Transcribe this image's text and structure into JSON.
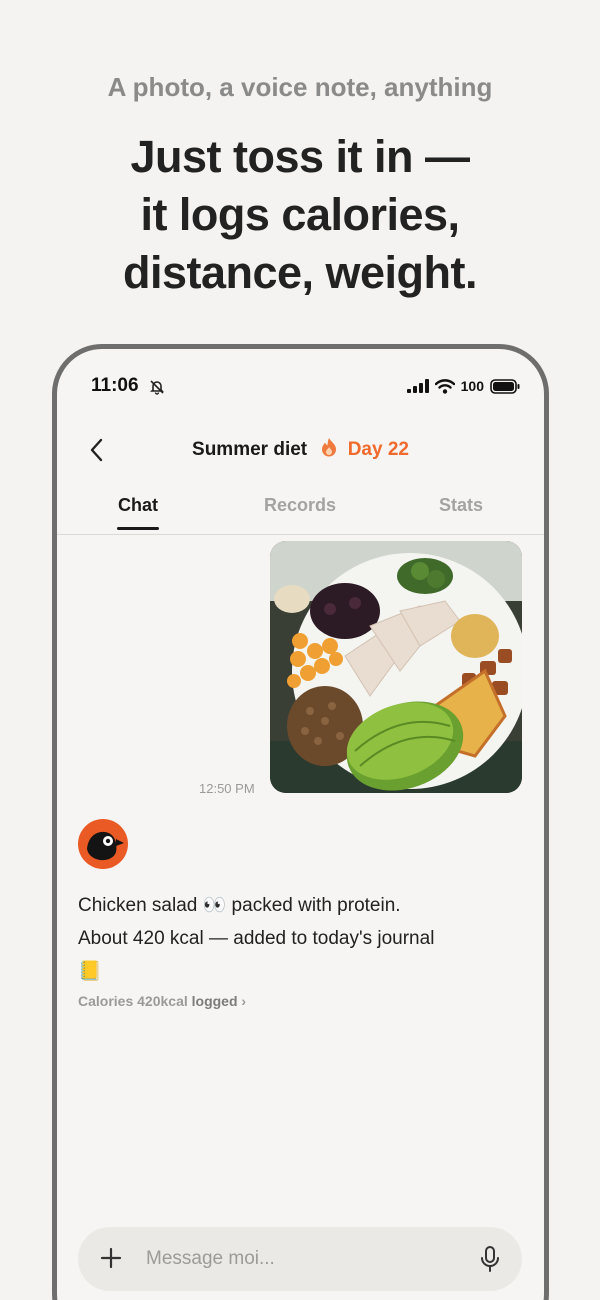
{
  "promo": {
    "subtitle": "A photo, a voice note, anything",
    "title_line1": "Just toss it in —",
    "title_line2": "it logs calories,",
    "title_line3": "distance, weight."
  },
  "status_bar": {
    "time": "11:06",
    "battery": "100"
  },
  "nav": {
    "title": "Summer diet",
    "streak": "Day 22",
    "accent_color": "#ef6a2c"
  },
  "tabs": [
    {
      "label": "Chat",
      "active": true
    },
    {
      "label": "Records",
      "active": false
    },
    {
      "label": "Stats",
      "active": false
    }
  ],
  "chat": {
    "photo_time": "12:50 PM",
    "bot_line1": "Chicken salad 👀  packed with protein.",
    "bot_line2": "About 420 kcal — added to today's journal",
    "bot_line3": "📒",
    "log_value": "Calories 420kcal",
    "log_status": "logged"
  },
  "composer": {
    "placeholder": "Message moi..."
  }
}
